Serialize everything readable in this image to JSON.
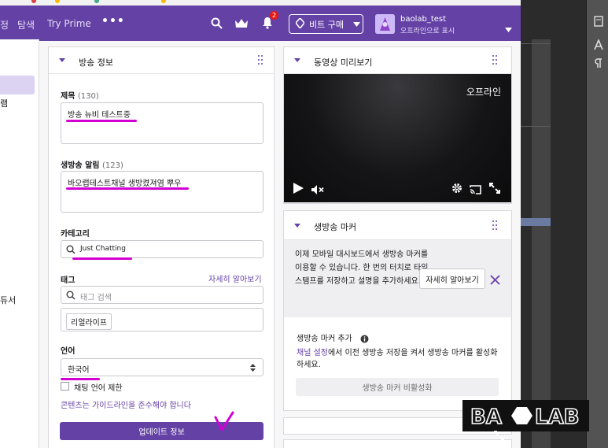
{
  "nav": {
    "link_fragment": "정",
    "link_browse": "탐색",
    "link_prime": "Try Prime",
    "more_label": "•••",
    "notification_count": "2",
    "bits_label": "비트 구매",
    "username": "baolab_test",
    "user_status": "오프라인으로 표시"
  },
  "leftbar": {
    "frag_1": "램",
    "frag_2": "듀서"
  },
  "stream_info": {
    "title": "방송 정보",
    "title_label": "제목",
    "title_count": "(130)",
    "title_value": "방송 뉴비 테스트중",
    "notification_label": "생방송 알림",
    "notification_count": "(123)",
    "notification_value": "바오랩테스트채널 생방켰져염 뿌우",
    "category_label": "카테고리",
    "category_value": "Just Chatting",
    "tags_label": "태그",
    "tags_learn_more": "자세히 알아보기",
    "tags_placeholder": "태그 검색",
    "tag_chip": "리얼라이프",
    "language_label": "언어",
    "language_value": "한국어",
    "chat_restrict_label": "채팅 언어 제한",
    "guideline_link": "콘텐츠는 가이드라인을 준수해야 합니다",
    "update_button": "업데이트 정보"
  },
  "preview": {
    "title": "동영상 미리보기",
    "offline": "오프라인"
  },
  "marker": {
    "title": "생방송 마커",
    "message": "이제 모바일 대시보드에서 생방송 마커를 이용할 수 있습니다. 한 번의 터치로 타임스탬프를 저장하고 설명을 추가하세요.",
    "learn_more": "자세히 알아보기",
    "add_label": "생방송 마커 추가",
    "settings_link": "채널 설정",
    "settings_text": "에서 이전 생방송 저장을 켜서 생방송 마커를 활성화하세요.",
    "disabled_button": "생방송 마커 비활성화"
  },
  "logo": {
    "text": "BAOLAB"
  },
  "colors": {
    "brand": "#6441a5",
    "annotation": "#d300d3",
    "notification": "#e91916"
  }
}
